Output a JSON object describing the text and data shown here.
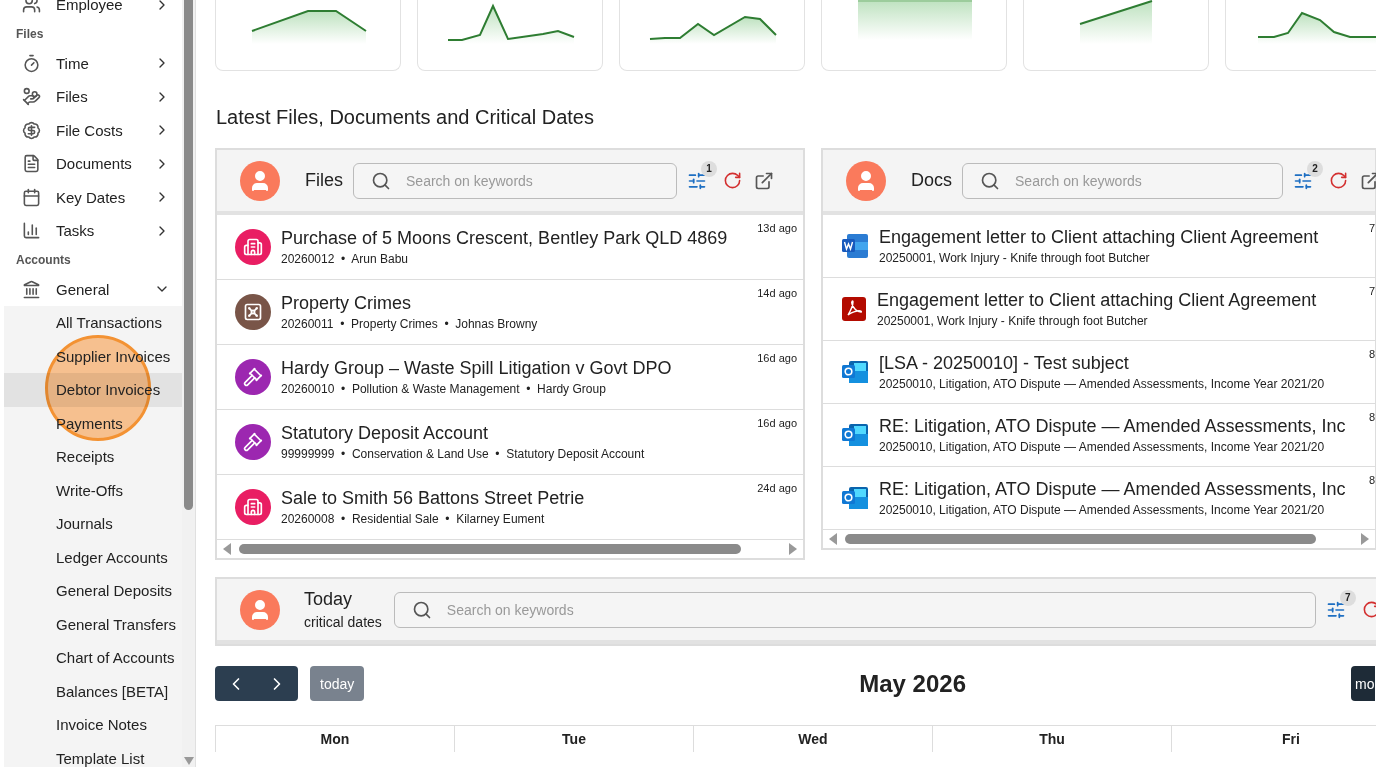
{
  "sidebar": {
    "items": [
      {
        "kind": "item",
        "label": "Employee",
        "expanded": false
      },
      {
        "kind": "section",
        "label": "Files"
      },
      {
        "kind": "item",
        "label": "Time",
        "expanded": false
      },
      {
        "kind": "item",
        "label": "Files",
        "expanded": false
      },
      {
        "kind": "item",
        "label": "File Costs",
        "expanded": false
      },
      {
        "kind": "item",
        "label": "Documents",
        "expanded": false
      },
      {
        "kind": "item",
        "label": "Key Dates",
        "expanded": false
      },
      {
        "kind": "item",
        "label": "Tasks",
        "expanded": false
      },
      {
        "kind": "section",
        "label": "Accounts"
      },
      {
        "kind": "item",
        "label": "General",
        "expanded": true
      },
      {
        "kind": "subitem",
        "label": "All Transactions",
        "selected": false
      },
      {
        "kind": "subitem",
        "label": "Supplier Invoices",
        "selected": false
      },
      {
        "kind": "subitem",
        "label": "Debtor Invoices",
        "selected": true
      },
      {
        "kind": "subitem",
        "label": "Payments",
        "selected": false
      },
      {
        "kind": "subitem",
        "label": "Receipts",
        "selected": false
      },
      {
        "kind": "subitem",
        "label": "Write-Offs",
        "selected": false
      },
      {
        "kind": "subitem",
        "label": "Journals",
        "selected": false
      },
      {
        "kind": "subitem",
        "label": "Ledger Accounts",
        "selected": false
      },
      {
        "kind": "subitem",
        "label": "General Deposits",
        "selected": false
      },
      {
        "kind": "subitem",
        "label": "General Transfers",
        "selected": false
      },
      {
        "kind": "subitem",
        "label": "Chart of Accounts",
        "selected": false
      },
      {
        "kind": "subitem",
        "label": "Balances [BETA]",
        "selected": false
      },
      {
        "kind": "subitem",
        "label": "Invoice Notes",
        "selected": false
      },
      {
        "kind": "subitem",
        "label": "Template List",
        "selected": false
      }
    ]
  },
  "trend_cards": [
    {
      "kind": "sparkline"
    },
    {
      "kind": "sparkline"
    },
    {
      "kind": "sparkline"
    },
    {
      "kind": "band"
    },
    {
      "kind": "sparkline"
    },
    {
      "kind": "sparkline"
    }
  ],
  "heading": "Latest Files, Documents and Critical Dates",
  "files_panel": {
    "title": "Files",
    "search": {
      "placeholder": "Search on keywords"
    },
    "filter_count": "1",
    "rows": [
      {
        "kind": "property",
        "color": "#e91e63",
        "title": "Purchase of 5 Moons Crescent, Bentley Park QLD 4869",
        "meta": "20260012  •  Arun Babu",
        "time": "13d ago"
      },
      {
        "kind": "safe",
        "color": "#795548",
        "title": "Property Crimes",
        "meta": "20260011  •  Property Crimes  •  Johnas Browny",
        "time": "14d ago"
      },
      {
        "kind": "gavel",
        "color": "#9c27b0",
        "title": "Hardy Group – Waste Spill Litigation v Govt DPO",
        "meta": "20260010  •  Pollution & Waste Management  •  Hardy Group",
        "time": "16d ago"
      },
      {
        "kind": "gavel",
        "color": "#9c27b0",
        "title": "Statutory Deposit Account",
        "meta": "99999999  •  Conservation & Land Use  •  Statutory Deposit Account",
        "time": "16d ago"
      },
      {
        "kind": "property",
        "color": "#e91e63",
        "title": "Sale to Smith 56 Battons Street Petrie",
        "meta": "20260008  •  Residential Sale  •  Kilarney Eument",
        "time": "24d ago"
      }
    ]
  },
  "docs_panel": {
    "title": "Docs",
    "search": {
      "placeholder": "Search on keywords"
    },
    "filter_count": "2",
    "rows": [
      {
        "kind": "word",
        "title": "Engagement letter to Client attaching Client Agreement",
        "meta": "20250001, Work Injury - Knife through foot Butcher",
        "time": "7"
      },
      {
        "kind": "pdf",
        "title": "Engagement letter to Client attaching Client Agreement",
        "meta": "20250001, Work Injury - Knife through foot Butcher",
        "time": "7"
      },
      {
        "kind": "mail",
        "title": "[LSA - 20250010] - Test subject",
        "meta": "20250010, Litigation, ATO Dispute — Amended Assessments, Income Year 2021/20",
        "time": "8"
      },
      {
        "kind": "mail",
        "title": "RE: Litigation, ATO Dispute — Amended Assessments, Inc",
        "meta": "20250010, Litigation, ATO Dispute — Amended Assessments, Income Year 2021/20",
        "time": "8"
      },
      {
        "kind": "mail",
        "title": "RE: Litigation, ATO Dispute — Amended Assessments, Inc",
        "meta": "20250010, Litigation, ATO Dispute — Amended Assessments, Income Year 2021/20",
        "time": "8"
      }
    ]
  },
  "today_panel": {
    "title": "Today",
    "subtitle": "critical dates",
    "search": {
      "placeholder": "Search on keywords"
    },
    "filter_count": "7"
  },
  "calendar": {
    "today_button": "today",
    "title": "May 2026",
    "view_button": "mo",
    "days": [
      "Mon",
      "Tue",
      "Wed",
      "Thu",
      "Fri"
    ]
  }
}
